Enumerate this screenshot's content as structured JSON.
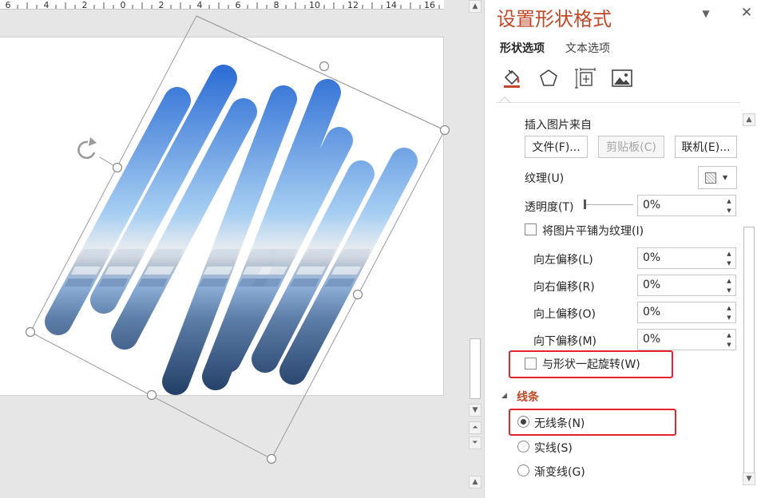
{
  "ruler": {
    "numbers": [
      "6",
      "4",
      "2",
      "0",
      "2",
      "4",
      "6",
      "8",
      "10",
      "12",
      "14",
      "16"
    ]
  },
  "canvas": {
    "rotate_icon": "rotate-handle-icon"
  },
  "pane": {
    "title": "设置形状格式",
    "tabs": {
      "shape_options": "形状选项",
      "text_options": "文本选项"
    },
    "icons": [
      "fill-line-icon",
      "effects-pentagon-icon",
      "size-properties-icon",
      "picture-icon"
    ],
    "insert_from": {
      "label": "插入图片来自",
      "file_button": "文件(F)...",
      "clipboard_button": "剪贴板(C)",
      "online_button": "联机(E)..."
    },
    "texture": {
      "label": "纹理(U)"
    },
    "transparency": {
      "label": "透明度(T)",
      "value": "0%"
    },
    "tile_checkbox": {
      "label": "将图片平铺为纹理(I)",
      "checked": false
    },
    "offsets": [
      {
        "label": "向左偏移(L)",
        "value": "0%"
      },
      {
        "label": "向右偏移(R)",
        "value": "0%"
      },
      {
        "label": "向上偏移(O)",
        "value": "0%"
      },
      {
        "label": "向下偏移(M)",
        "value": "0%"
      }
    ],
    "rotate_with_shape": {
      "label": "与形状一起旋转(W)",
      "checked": false
    },
    "line_section": {
      "title": "线条",
      "options": [
        {
          "label": "无线条(N)",
          "selected": true
        },
        {
          "label": "实线(S)",
          "selected": false
        },
        {
          "label": "渐变线(G)",
          "selected": false
        }
      ]
    }
  },
  "colors": {
    "title_accent": "#c24727",
    "highlight": "#e3242b",
    "section_title": "#c24727"
  }
}
